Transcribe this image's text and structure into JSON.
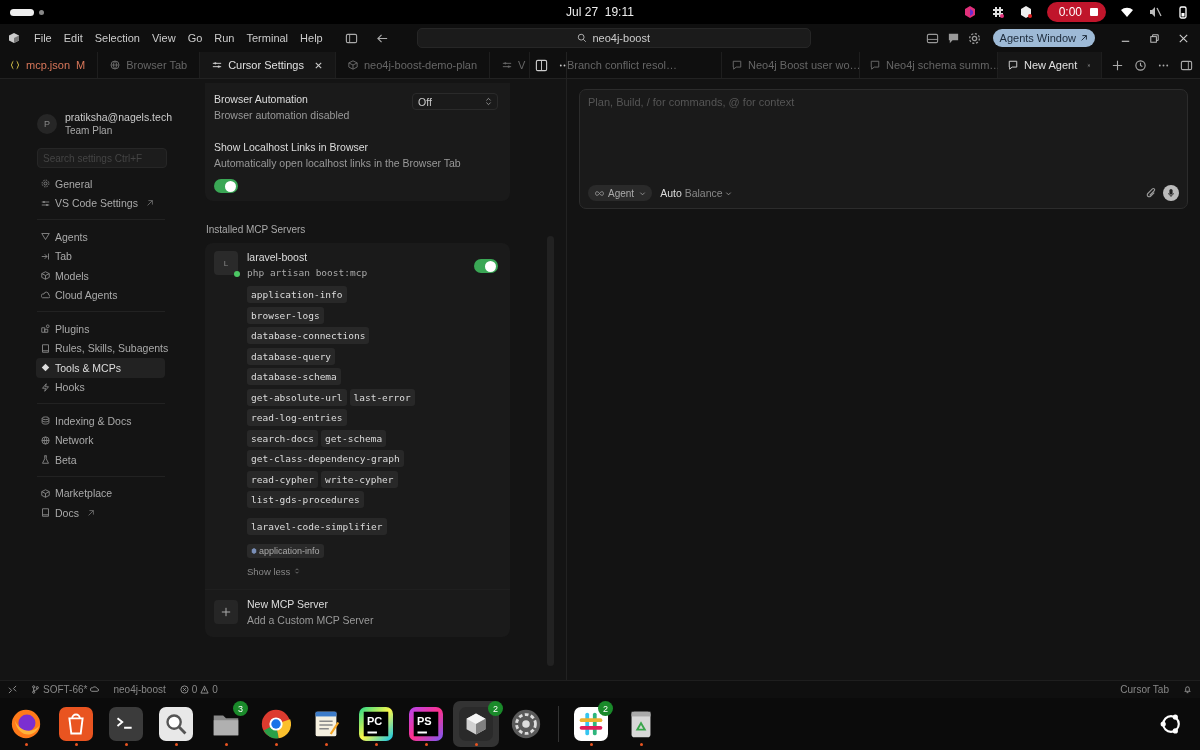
{
  "top_bar": {
    "clock": "Jul 27  19:11",
    "recording": "0:00"
  },
  "menu_bar": {
    "menus": [
      "File",
      "Edit",
      "Selection",
      "View",
      "Go",
      "Run",
      "Terminal",
      "Help"
    ],
    "search": "neo4j-boost",
    "agents_button": "Agents Window"
  },
  "editor_tabs": [
    {
      "label": "mcp.json",
      "badge": "M",
      "kind": "braces",
      "selected": false
    },
    {
      "label": "Browser Tab",
      "kind": "globe",
      "selected": false
    },
    {
      "label": "Cursor Settings",
      "kind": "sliders",
      "selected": true
    },
    {
      "label": "neo4j-boost-demo-plan",
      "kind": "cube",
      "selected": false
    },
    {
      "label": "V",
      "kind": "sliders",
      "selected": false
    }
  ],
  "agent_tabs": [
    {
      "label": "Branch conflict resol…",
      "kind": "plain",
      "selected": false
    },
    {
      "label": "Neo4j Boost user wo…",
      "kind": "chat",
      "selected": false
    },
    {
      "label": "Neo4j schema summ…",
      "kind": "chat",
      "selected": false
    },
    {
      "label": "New Agent",
      "kind": "chat",
      "selected": true
    }
  ],
  "settings_sidebar": {
    "account": {
      "initial": "P",
      "email": "pratiksha@nagels.tech",
      "plan": "Team Plan"
    },
    "search_placeholder": "Search settings Ctrl+F",
    "groups": [
      [
        {
          "label": "General",
          "kind": "gear",
          "external": false,
          "selected": false
        },
        {
          "label": "VS Code Settings",
          "kind": "sliders",
          "external": true,
          "selected": false
        }
      ],
      [
        {
          "label": "Agents",
          "kind": "funnel",
          "external": false,
          "selected": false
        },
        {
          "label": "Tab",
          "kind": "tabkey",
          "external": false,
          "selected": false
        },
        {
          "label": "Models",
          "kind": "cube",
          "external": false,
          "selected": false
        },
        {
          "label": "Cloud Agents",
          "kind": "cloud",
          "external": false,
          "selected": false
        }
      ],
      [
        {
          "label": "Plugins",
          "kind": "blocks",
          "external": false,
          "selected": false
        },
        {
          "label": "Rules, Skills, Subagents",
          "kind": "book",
          "external": false,
          "selected": false
        },
        {
          "label": "Tools & MCPs",
          "kind": "diamond",
          "external": false,
          "selected": true
        },
        {
          "label": "Hooks",
          "kind": "bolt",
          "external": false,
          "selected": false
        }
      ],
      [
        {
          "label": "Indexing & Docs",
          "kind": "database",
          "external": false,
          "selected": false
        },
        {
          "label": "Network",
          "kind": "globe",
          "external": false,
          "selected": false
        },
        {
          "label": "Beta",
          "kind": "flask",
          "external": false,
          "selected": false
        }
      ],
      [
        {
          "label": "Marketplace",
          "kind": "cube",
          "external": false,
          "selected": false
        },
        {
          "label": "Docs",
          "kind": "book",
          "external": true,
          "selected": false
        }
      ]
    ]
  },
  "settings": {
    "browser_automation": {
      "title": "Browser Automation",
      "description": "Browser automation disabled",
      "value": "Off"
    },
    "localhost_links": {
      "title": "Show Localhost Links in Browser",
      "description": "Automatically open localhost links in the Browser Tab",
      "on": true
    },
    "section_title": "Installed MCP Servers",
    "servers": [
      {
        "initial": "L",
        "name": "laravel-boost",
        "command": "php artisan boost:mcp",
        "connected": true,
        "on": true,
        "tool_rows": [
          [
            "application-info"
          ],
          [
            "browser-logs"
          ],
          [
            "database-connections"
          ],
          [
            "database-query"
          ],
          [
            "database-schema"
          ],
          [
            "get-absolute-url",
            "last-error"
          ],
          [
            "read-log-entries"
          ],
          [
            "search-docs",
            "get-schema"
          ],
          [
            "get-class-dependency-graph"
          ],
          [
            "read-cypher",
            "write-cypher"
          ],
          [
            "list-gds-procedures"
          ]
        ],
        "prompts": [
          "laravel-code-simplifier"
        ],
        "resources": [
          "application-info"
        ],
        "toggle_text": "Show less"
      }
    ],
    "new_server": {
      "title": "New MCP Server",
      "subtitle": "Add a Custom MCP Server"
    }
  },
  "composer": {
    "placeholder": "Plan, Build, / for commands, @ for context",
    "mode": "Agent",
    "model": "Auto",
    "model_detail": "Balance"
  },
  "status_bar": {
    "branch": "SOFT-66*",
    "project": "neo4j-boost",
    "errors": "0",
    "warnings": "0",
    "right": "Cursor Tab"
  },
  "dock": [
    {
      "kind": "firefox",
      "running": true,
      "selected": false
    },
    {
      "kind": "store",
      "running": true,
      "selected": false
    },
    {
      "kind": "terminal",
      "running": true,
      "selected": false
    },
    {
      "kind": "search",
      "running": true,
      "selected": false
    },
    {
      "kind": "files",
      "badge": "3",
      "running": true,
      "selected": false
    },
    {
      "kind": "chrome",
      "running": true,
      "selected": false
    },
    {
      "kind": "editor",
      "running": true,
      "selected": false
    },
    {
      "kind": "pycharm",
      "label": "PC",
      "running": true,
      "selected": false
    },
    {
      "kind": "phpstorm",
      "label": "PS",
      "running": true,
      "selected": false
    },
    {
      "kind": "cursor",
      "badge": "2",
      "running": true,
      "selected": true
    },
    {
      "kind": "settings",
      "running": false,
      "selected": false
    },
    {
      "kind": "slack",
      "badge": "2",
      "running": true,
      "selected": false
    },
    {
      "kind": "trash",
      "running": true,
      "selected": false
    }
  ]
}
